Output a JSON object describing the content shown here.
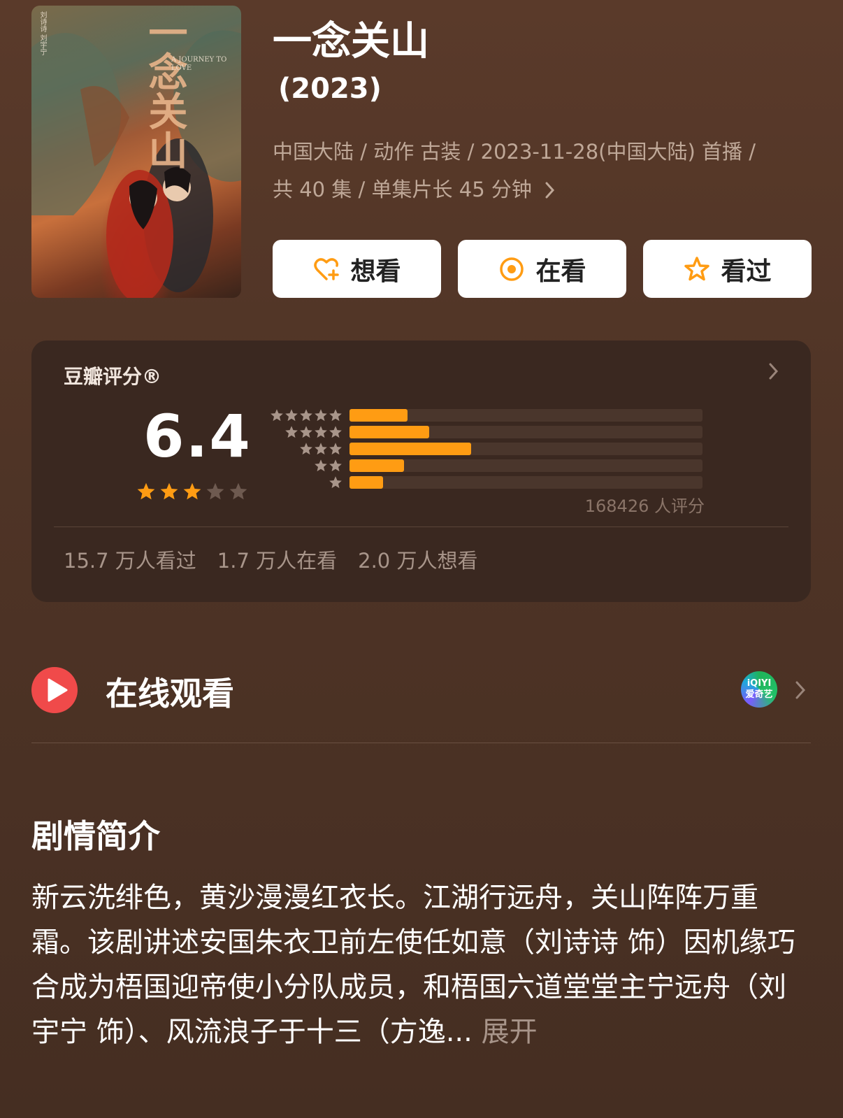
{
  "poster": {
    "title_art": "一念关山",
    "credit": "刘诗诗 刘宇宁",
    "subtitle_en": "A JOURNEY TO LOVE"
  },
  "show": {
    "title": "一念关山",
    "year": "(2023)",
    "meta_line1": "中国大陆 / 动作 古装 / 2023-11-28(中国大陆) 首播 /",
    "meta_line2": "共 40 集 / 单集片长 45 分钟"
  },
  "actions": [
    {
      "label": "想看",
      "icon": "heart-plus-icon"
    },
    {
      "label": "在看",
      "icon": "target-icon"
    },
    {
      "label": "看过",
      "icon": "star-outline-icon"
    }
  ],
  "rating": {
    "header": "豆瓣评分®",
    "score": "6.4",
    "score_stars": 3,
    "distribution": [
      {
        "stars": 5,
        "fraction": 0.165
      },
      {
        "stars": 4,
        "fraction": 0.225
      },
      {
        "stars": 3,
        "fraction": 0.345
      },
      {
        "stars": 2,
        "fraction": 0.155
      },
      {
        "stars": 1,
        "fraction": 0.095
      }
    ],
    "count_text": "168426 人评分",
    "stats": [
      "15.7 万人看过",
      "1.7 万人在看",
      "2.0 万人想看"
    ]
  },
  "watch": {
    "label": "在线观看",
    "provider_logo": "iQIYI\n爱奇艺",
    "provider_logo_line1": "iQIYI",
    "provider_logo_line2": "爱奇艺"
  },
  "synopsis": {
    "title": "剧情简介",
    "text": "新云洗绯色，黄沙漫漫红衣长。江湖行远舟，关山阵阵万重霜。该剧讲述安国朱衣卫前左使任如意（刘诗诗 饰）因机缘巧合成为梧国迎帝使小分队成员，和梧国六道堂堂主宁远舟（刘宇宁 饰）、风流浪子于十三（方逸...",
    "more_label": "展开"
  },
  "colors": {
    "accent_orange": "#ff9c13",
    "play_red": "#f04a4a",
    "background": "#4f3426"
  }
}
